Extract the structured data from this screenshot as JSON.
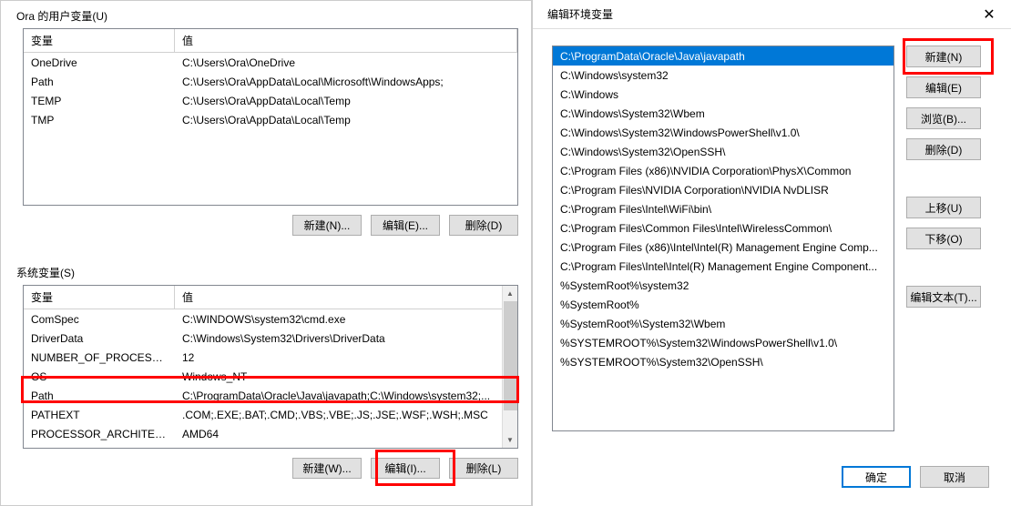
{
  "left": {
    "user_vars_label": "Ora 的用户变量(U)",
    "sys_vars_label": "系统变量(S)",
    "col_var": "变量",
    "col_val": "值",
    "user_rows": [
      {
        "var": "OneDrive",
        "val": "C:\\Users\\Ora\\OneDrive"
      },
      {
        "var": "Path",
        "val": "C:\\Users\\Ora\\AppData\\Local\\Microsoft\\WindowsApps;"
      },
      {
        "var": "TEMP",
        "val": "C:\\Users\\Ora\\AppData\\Local\\Temp"
      },
      {
        "var": "TMP",
        "val": "C:\\Users\\Ora\\AppData\\Local\\Temp"
      }
    ],
    "sys_rows": [
      {
        "var": "ComSpec",
        "val": "C:\\WINDOWS\\system32\\cmd.exe"
      },
      {
        "var": "DriverData",
        "val": "C:\\Windows\\System32\\Drivers\\DriverData"
      },
      {
        "var": "NUMBER_OF_PROCESSORS",
        "val": "12"
      },
      {
        "var": "OS",
        "val": "Windows_NT"
      },
      {
        "var": "Path",
        "val": "C:\\ProgramData\\Oracle\\Java\\javapath;C:\\Windows\\system32;..."
      },
      {
        "var": "PATHEXT",
        "val": ".COM;.EXE;.BAT;.CMD;.VBS;.VBE;.JS;.JSE;.WSF;.WSH;.MSC"
      },
      {
        "var": "PROCESSOR_ARCHITECT...",
        "val": "AMD64"
      }
    ],
    "user_btns": {
      "new": "新建(N)...",
      "edit": "编辑(E)...",
      "del": "删除(D)"
    },
    "sys_btns": {
      "new": "新建(W)...",
      "edit": "编辑(I)...",
      "del": "删除(L)"
    }
  },
  "right": {
    "title": "编辑环境变量",
    "paths": [
      "C:\\ProgramData\\Oracle\\Java\\javapath",
      "C:\\Windows\\system32",
      "C:\\Windows",
      "C:\\Windows\\System32\\Wbem",
      "C:\\Windows\\System32\\WindowsPowerShell\\v1.0\\",
      "C:\\Windows\\System32\\OpenSSH\\",
      "C:\\Program Files (x86)\\NVIDIA Corporation\\PhysX\\Common",
      "C:\\Program Files\\NVIDIA Corporation\\NVIDIA NvDLISR",
      "C:\\Program Files\\Intel\\WiFi\\bin\\",
      "C:\\Program Files\\Common Files\\Intel\\WirelessCommon\\",
      "C:\\Program Files (x86)\\Intel\\Intel(R) Management Engine Comp...",
      "C:\\Program Files\\Intel\\Intel(R) Management Engine Component...",
      "%SystemRoot%\\system32",
      "%SystemRoot%",
      "%SystemRoot%\\System32\\Wbem",
      "%SYSTEMROOT%\\System32\\WindowsPowerShell\\v1.0\\",
      "%SYSTEMROOT%\\System32\\OpenSSH\\"
    ],
    "btns": {
      "new": "新建(N)",
      "edit": "编辑(E)",
      "browse": "浏览(B)...",
      "del": "删除(D)",
      "up": "上移(U)",
      "down": "下移(O)",
      "edit_text": "编辑文本(T)..."
    },
    "ok": "确定",
    "cancel": "取消"
  }
}
